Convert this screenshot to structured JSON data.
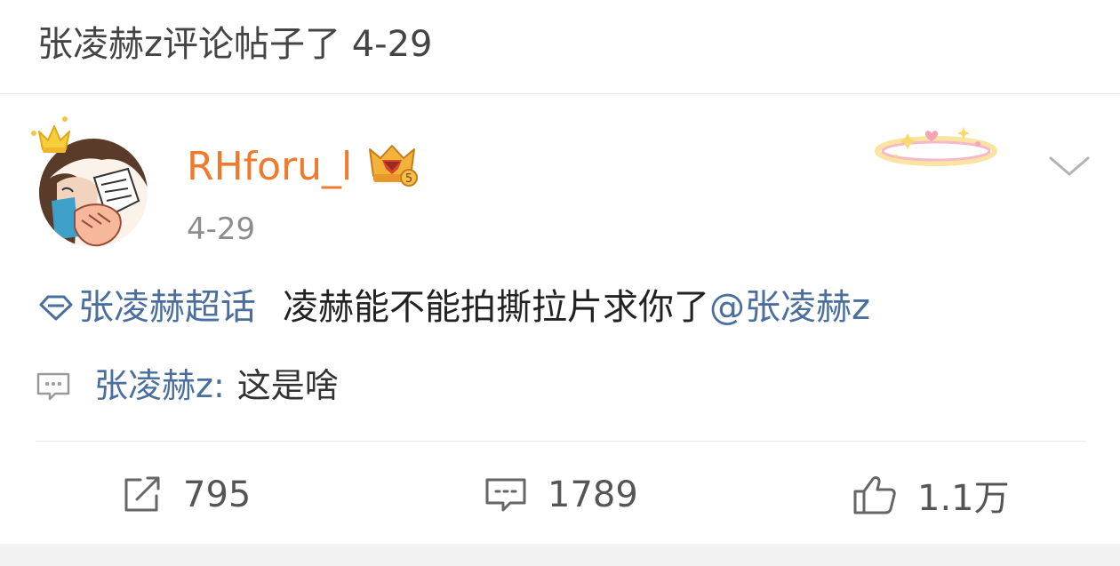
{
  "header": {
    "title": "张凌赫z评论帖子了 4-29"
  },
  "post": {
    "username": "RHforu_l",
    "time": "4-29",
    "topic": "张凌赫超话",
    "text": "凌赫能不能拍撕拉片求你了",
    "mention": "@张凌赫z",
    "vip_level": "5"
  },
  "comment_preview": {
    "author": "张凌赫z",
    "colon": ":",
    "text": "这是啥"
  },
  "actions": {
    "repost_count": "795",
    "comment_count": "1789",
    "like_count": "1.1万"
  },
  "colors": {
    "username": "#ef7a2c",
    "link": "#4a6f9e",
    "time": "#8d8d8d"
  }
}
